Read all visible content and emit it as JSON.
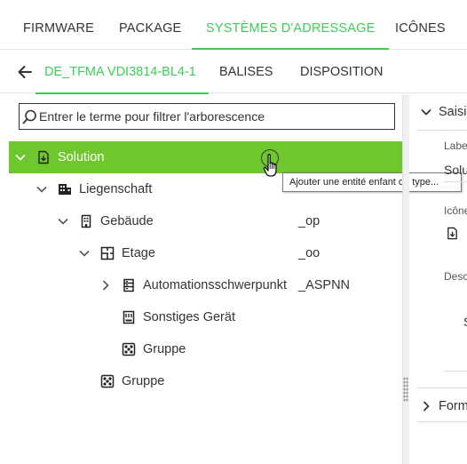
{
  "top_tabs": [
    {
      "label": "FIRMWARE"
    },
    {
      "label": "PACKAGE"
    },
    {
      "label": "SYSTÈMES D'ADRESSAGE"
    },
    {
      "label": "ICÔNES"
    }
  ],
  "sub_tabs": [
    {
      "label": "DE_TFMA VDI3814-BL4-1"
    },
    {
      "label": "BALISES"
    },
    {
      "label": "DISPOSITION"
    }
  ],
  "search": {
    "placeholder": "Entrer le terme pour filtrer l'arborescence"
  },
  "tree": [
    {
      "label": "Solution",
      "code": ""
    },
    {
      "label": "Liegenschaft",
      "code": ""
    },
    {
      "label": "Gebäude",
      "code": "_op"
    },
    {
      "label": "Etage",
      "code": "_oo"
    },
    {
      "label": "Automationsschwerpunkt",
      "code": "_ASPNN"
    },
    {
      "label": "Sonstiges Gerät",
      "code": ""
    },
    {
      "label": "Gruppe",
      "code": ""
    },
    {
      "label": "Gruppe",
      "code": ""
    }
  ],
  "tooltip": "Ajouter une entité enfant du type...",
  "right_panel": {
    "section_title": "Saisi",
    "label_caption": "Labe",
    "label_value": "Solu",
    "icon_caption": "Icône",
    "description_caption": "Desc",
    "desc_fragment": "S",
    "footer_section": "Form"
  },
  "colors": {
    "accent": "#3dcd58",
    "selected_row": "#6ec72d"
  }
}
